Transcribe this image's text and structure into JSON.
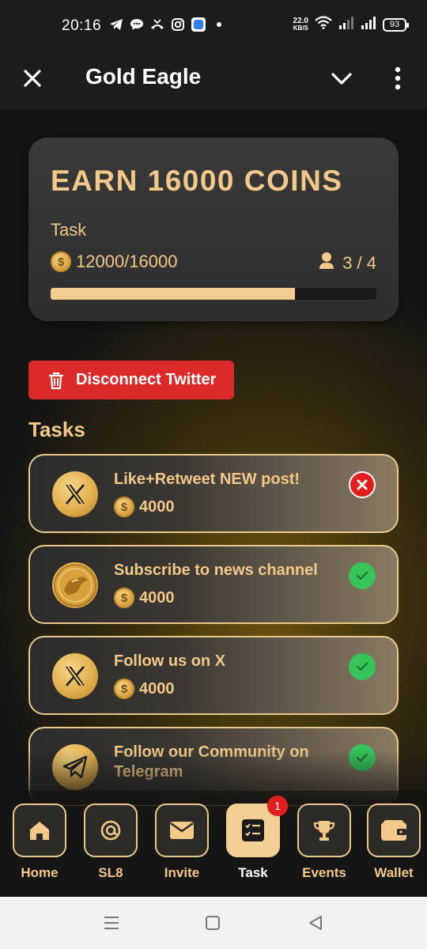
{
  "status_bar": {
    "time": "20:16",
    "net_speed_value": "22.0",
    "net_speed_unit": "KB/S",
    "battery": "93",
    "left_icons": [
      "telegram-icon",
      "chat-icon",
      "missed-call-icon",
      "instagram-icon",
      "app-icon",
      "dot-icon"
    ],
    "right_icons": [
      "wifi-icon",
      "signal-icon",
      "signal-icon"
    ]
  },
  "header": {
    "title": "Gold Eagle"
  },
  "earn_card": {
    "title": "EARN 16000 COINS",
    "subtitle": "Task",
    "progress_text": "12000/16000",
    "progress_fraction": 0.75,
    "users_text": "3 / 4"
  },
  "disconnect_button": {
    "label": "Disconnect Twitter"
  },
  "tasks_heading": "Tasks",
  "tasks": [
    {
      "title": "Like+Retweet NEW post!",
      "reward": "4000",
      "icon": "x-logo-icon",
      "status": "failed"
    },
    {
      "title": "Subscribe to news channel",
      "reward": "4000",
      "icon": "gold-eagle-coin-icon",
      "status": "done"
    },
    {
      "title": "Follow us on X",
      "reward": "4000",
      "icon": "x-logo-icon",
      "status": "done"
    },
    {
      "title": "Follow our Community on Telegram",
      "reward": "",
      "icon": "telegram-icon",
      "status": "done"
    }
  ],
  "bottom_nav": [
    {
      "label": "Home",
      "icon": "home-icon",
      "active": false
    },
    {
      "label": "SL8",
      "icon": "at-icon",
      "active": false
    },
    {
      "label": "Invite",
      "icon": "mail-icon",
      "active": false
    },
    {
      "label": "Task",
      "icon": "checklist-icon",
      "active": true,
      "badge": "1"
    },
    {
      "label": "Events",
      "icon": "trophy-icon",
      "active": false
    },
    {
      "label": "Wallet",
      "icon": "wallet-icon",
      "active": false
    }
  ],
  "colors": {
    "accent_gold": "#f2c98a",
    "danger_red": "#dc2a2a",
    "success_green": "#35c35a"
  }
}
